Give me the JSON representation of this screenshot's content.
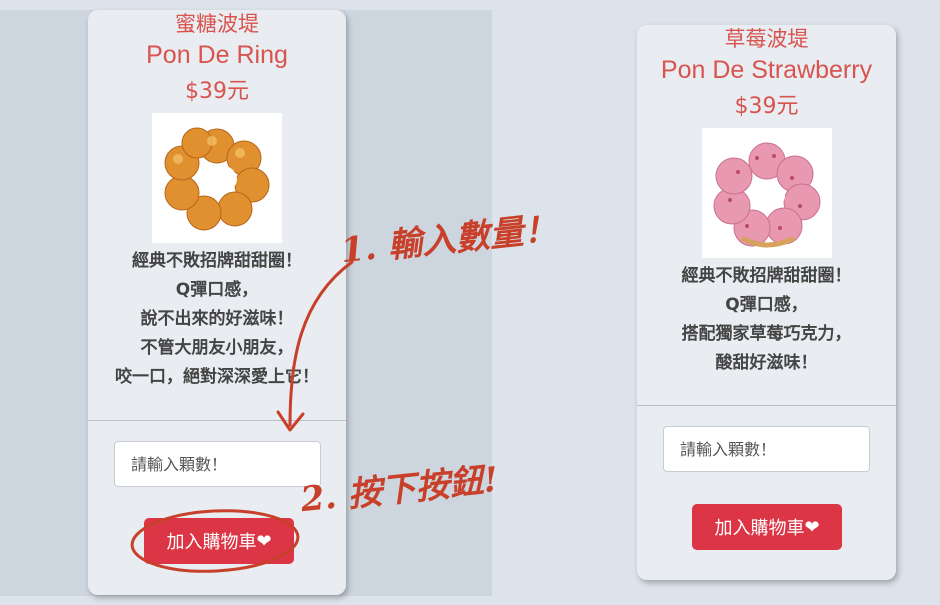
{
  "products": [
    {
      "name_zh": "蜜糖波堤",
      "name_en": "Pon De Ring",
      "price": "$39元",
      "description": [
        "經典不敗招牌甜甜圈！",
        "Q彈口感，",
        "說不出來的好滋味！",
        "不管大朋友小朋友，",
        "咬一口，絕對深深愛上它！"
      ],
      "qty_placeholder": "請輸入顆數！",
      "button_label": "加入購物車",
      "button_icon": "heart-icon"
    },
    {
      "name_zh": "草莓波堤",
      "name_en": "Pon De Strawberry",
      "price": "$39元",
      "description": [
        "經典不敗招牌甜甜圈！",
        "Q彈口感，",
        "搭配獨家草莓巧克力，",
        "酸甜好滋味！"
      ],
      "qty_placeholder": "請輸入顆數！",
      "button_label": "加入購物車",
      "button_icon": "heart-icon"
    }
  ],
  "annotations": {
    "step1": "1. 輸入數量！",
    "step2": "2. 按下按鈕!"
  },
  "colors": {
    "accent": "#dc3545",
    "title": "#d9534f",
    "annotation": "#c8402a"
  }
}
